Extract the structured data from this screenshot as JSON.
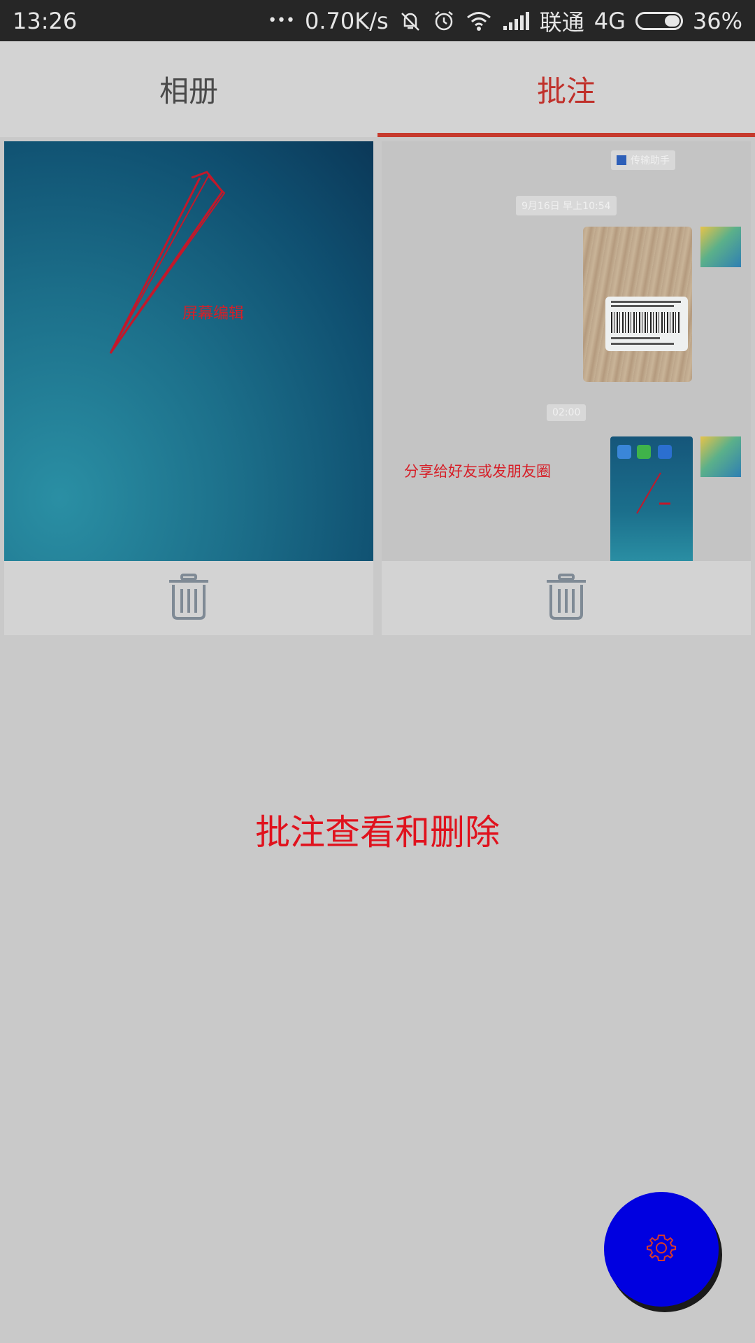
{
  "status_bar": {
    "time": "13:26",
    "dots": "•••",
    "net_speed": "0.70K/s",
    "carrier": "联通",
    "network": "4G",
    "battery": "36%",
    "battery_level": 0.36,
    "icons": [
      "mute-icon",
      "alarm-icon",
      "wifi-icon",
      "signal-icon",
      "battery-icon"
    ]
  },
  "tabs": [
    {
      "label": "相册",
      "active": false
    },
    {
      "label": "批注",
      "active": true
    }
  ],
  "cards": [
    {
      "annotation_text": "屏幕编辑",
      "delete_icon": "trash-icon"
    },
    {
      "chat_title": "传输助手",
      "chat_date": "9月16日 早上10:54",
      "chat_time": "02:00",
      "annotation_text": "分享给好友或发朋友圈",
      "delete_icon": "trash-icon"
    }
  ],
  "caption": "批注查看和删除",
  "fab": {
    "icon": "gear-icon"
  },
  "colors": {
    "accent_red": "#c63a2d",
    "caption_red": "#e0121d",
    "fab_blue": "#0000e0",
    "background": "#c9c9c9"
  }
}
